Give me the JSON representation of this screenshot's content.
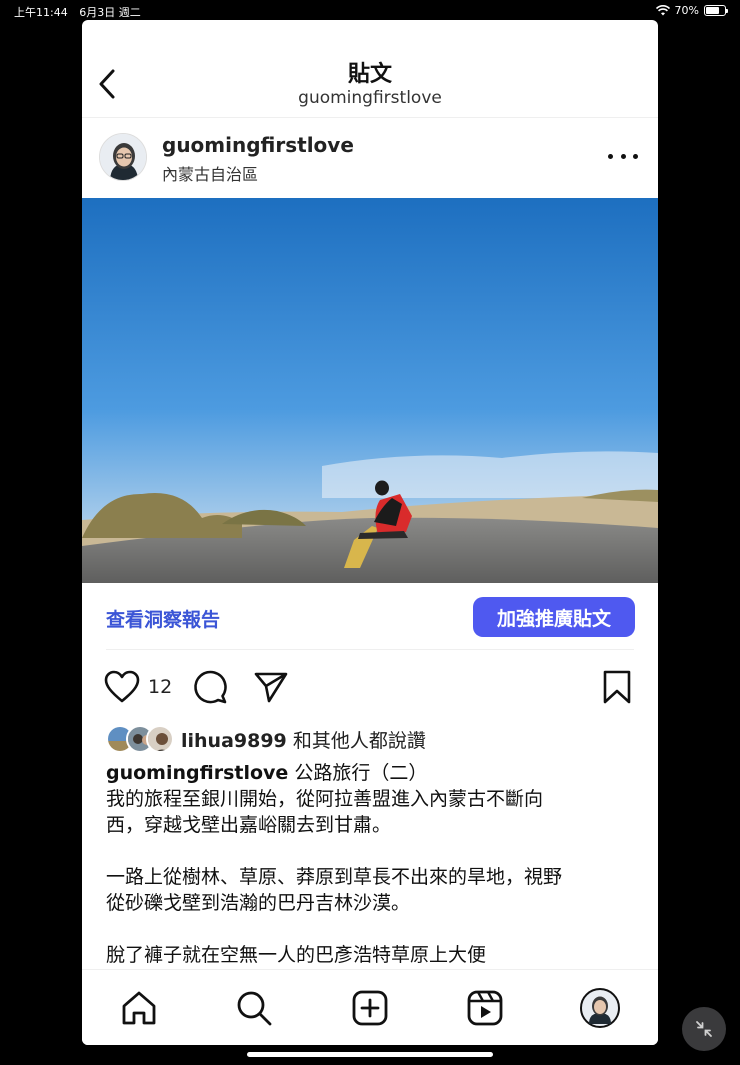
{
  "status_bar": {
    "time": "上午11:44",
    "date": "6月3日 週二",
    "battery": "70%",
    "battery_level": 0.7
  },
  "nav": {
    "title": "貼文",
    "subtitle": "guomingfirstlove"
  },
  "post": {
    "username": "guomingfirstlove",
    "location": "內蒙古自治區",
    "insights_label": "查看洞察報告",
    "boost_label": "加強推廣貼文",
    "like_count": "12",
    "liked_by": {
      "name": "lihua9899",
      "suffix": "和其他人都說讚"
    },
    "caption": {
      "username": "guomingfirstlove",
      "title": "公路旅行（二）",
      "lines": [
        "我的旅程至銀川開始，從阿拉善盟進入內蒙古不斷向",
        "西，穿越戈壁出嘉峪關去到甘肅。",
        "一路上從樹林、草原、莽原到草長不出來的旱地，視野",
        "從砂礫戈壁到浩瀚的巴丹吉林沙漠。",
        "脫了褲子就在空無一人的巴彥浩特草原上大便"
      ]
    }
  },
  "tabs": [
    "home-icon",
    "search-icon",
    "create-icon",
    "reels-icon",
    "profile-avatar"
  ],
  "colors": {
    "accent": "#4f59f0",
    "link": "#3b55d6",
    "sky_top": "#1d6fc0",
    "sky_bottom": "#d9e6f0"
  }
}
